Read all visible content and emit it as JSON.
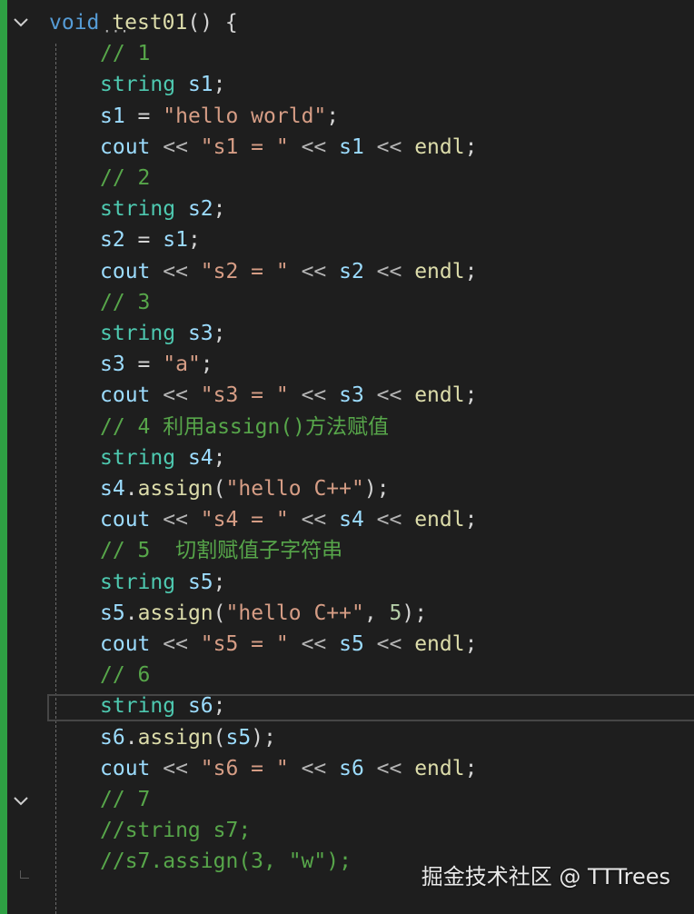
{
  "editor": {
    "lines": [
      {
        "indent": 0,
        "tokens": [
          {
            "t": "void",
            "c": "kw"
          },
          {
            "t": " ",
            "c": "punc"
          },
          {
            "t": "test01",
            "c": "fn"
          },
          {
            "t": "() {",
            "c": "punc"
          }
        ]
      },
      {
        "indent": 1,
        "tokens": [
          {
            "t": "// 1",
            "c": "cmt"
          }
        ]
      },
      {
        "indent": 1,
        "tokens": [
          {
            "t": "string",
            "c": "type"
          },
          {
            "t": " ",
            "c": "punc"
          },
          {
            "t": "s1",
            "c": "var"
          },
          {
            "t": ";",
            "c": "punc"
          }
        ]
      },
      {
        "indent": 1,
        "tokens": [
          {
            "t": "s1",
            "c": "var"
          },
          {
            "t": " = ",
            "c": "punc"
          },
          {
            "t": "\"hello world\"",
            "c": "str"
          },
          {
            "t": ";",
            "c": "punc"
          }
        ]
      },
      {
        "indent": 1,
        "tokens": [
          {
            "t": "cout",
            "c": "var"
          },
          {
            "t": " << ",
            "c": "op"
          },
          {
            "t": "\"s1 = \"",
            "c": "str"
          },
          {
            "t": " << ",
            "c": "op"
          },
          {
            "t": "s1",
            "c": "var"
          },
          {
            "t": " << ",
            "c": "op"
          },
          {
            "t": "endl",
            "c": "fn"
          },
          {
            "t": ";",
            "c": "punc"
          }
        ]
      },
      {
        "indent": 1,
        "tokens": [
          {
            "t": "// 2",
            "c": "cmt"
          }
        ]
      },
      {
        "indent": 1,
        "tokens": [
          {
            "t": "string",
            "c": "type"
          },
          {
            "t": " ",
            "c": "punc"
          },
          {
            "t": "s2",
            "c": "var"
          },
          {
            "t": ";",
            "c": "punc"
          }
        ]
      },
      {
        "indent": 1,
        "tokens": [
          {
            "t": "s2",
            "c": "var"
          },
          {
            "t": " = ",
            "c": "punc"
          },
          {
            "t": "s1",
            "c": "var"
          },
          {
            "t": ";",
            "c": "punc"
          }
        ]
      },
      {
        "indent": 1,
        "tokens": [
          {
            "t": "cout",
            "c": "var"
          },
          {
            "t": " << ",
            "c": "op"
          },
          {
            "t": "\"s2 = \"",
            "c": "str"
          },
          {
            "t": " << ",
            "c": "op"
          },
          {
            "t": "s2",
            "c": "var"
          },
          {
            "t": " << ",
            "c": "op"
          },
          {
            "t": "endl",
            "c": "fn"
          },
          {
            "t": ";",
            "c": "punc"
          }
        ]
      },
      {
        "indent": 1,
        "tokens": [
          {
            "t": "// 3",
            "c": "cmt"
          }
        ]
      },
      {
        "indent": 1,
        "tokens": [
          {
            "t": "string",
            "c": "type"
          },
          {
            "t": " ",
            "c": "punc"
          },
          {
            "t": "s3",
            "c": "var"
          },
          {
            "t": ";",
            "c": "punc"
          }
        ]
      },
      {
        "indent": 1,
        "tokens": [
          {
            "t": "s3",
            "c": "var"
          },
          {
            "t": " = ",
            "c": "punc"
          },
          {
            "t": "\"a\"",
            "c": "str"
          },
          {
            "t": ";",
            "c": "punc"
          }
        ]
      },
      {
        "indent": 1,
        "tokens": [
          {
            "t": "cout",
            "c": "var"
          },
          {
            "t": " << ",
            "c": "op"
          },
          {
            "t": "\"s3 = \"",
            "c": "str"
          },
          {
            "t": " << ",
            "c": "op"
          },
          {
            "t": "s3",
            "c": "var"
          },
          {
            "t": " << ",
            "c": "op"
          },
          {
            "t": "endl",
            "c": "fn"
          },
          {
            "t": ";",
            "c": "punc"
          }
        ]
      },
      {
        "indent": 1,
        "tokens": [
          {
            "t": "// 4 利用assign()方法赋值",
            "c": "cmt"
          }
        ]
      },
      {
        "indent": 1,
        "tokens": [
          {
            "t": "string",
            "c": "type"
          },
          {
            "t": " ",
            "c": "punc"
          },
          {
            "t": "s4",
            "c": "var"
          },
          {
            "t": ";",
            "c": "punc"
          }
        ]
      },
      {
        "indent": 1,
        "tokens": [
          {
            "t": "s4",
            "c": "var"
          },
          {
            "t": ".",
            "c": "punc"
          },
          {
            "t": "assign",
            "c": "fn"
          },
          {
            "t": "(",
            "c": "punc"
          },
          {
            "t": "\"hello C++\"",
            "c": "str"
          },
          {
            "t": ");",
            "c": "punc"
          }
        ]
      },
      {
        "indent": 1,
        "tokens": [
          {
            "t": "cout",
            "c": "var"
          },
          {
            "t": " << ",
            "c": "op"
          },
          {
            "t": "\"s4 = \"",
            "c": "str"
          },
          {
            "t": " << ",
            "c": "op"
          },
          {
            "t": "s4",
            "c": "var"
          },
          {
            "t": " << ",
            "c": "op"
          },
          {
            "t": "endl",
            "c": "fn"
          },
          {
            "t": ";",
            "c": "punc"
          }
        ]
      },
      {
        "indent": 1,
        "tokens": [
          {
            "t": "// 5  切割赋值子字符串",
            "c": "cmt"
          }
        ]
      },
      {
        "indent": 1,
        "tokens": [
          {
            "t": "string",
            "c": "type"
          },
          {
            "t": " ",
            "c": "punc"
          },
          {
            "t": "s5",
            "c": "var"
          },
          {
            "t": ";",
            "c": "punc"
          }
        ]
      },
      {
        "indent": 1,
        "tokens": [
          {
            "t": "s5",
            "c": "var"
          },
          {
            "t": ".",
            "c": "punc"
          },
          {
            "t": "assign",
            "c": "fn"
          },
          {
            "t": "(",
            "c": "punc"
          },
          {
            "t": "\"hello C++\"",
            "c": "str"
          },
          {
            "t": ", ",
            "c": "punc"
          },
          {
            "t": "5",
            "c": "num"
          },
          {
            "t": ");",
            "c": "punc"
          }
        ]
      },
      {
        "indent": 1,
        "tokens": [
          {
            "t": "cout",
            "c": "var"
          },
          {
            "t": " << ",
            "c": "op"
          },
          {
            "t": "\"s5 = \"",
            "c": "str"
          },
          {
            "t": " << ",
            "c": "op"
          },
          {
            "t": "s5",
            "c": "var"
          },
          {
            "t": " << ",
            "c": "op"
          },
          {
            "t": "endl",
            "c": "fn"
          },
          {
            "t": ";",
            "c": "punc"
          }
        ]
      },
      {
        "indent": 1,
        "tokens": [
          {
            "t": "// 6",
            "c": "cmt"
          }
        ]
      },
      {
        "indent": 1,
        "tokens": [
          {
            "t": "string",
            "c": "type"
          },
          {
            "t": " ",
            "c": "punc"
          },
          {
            "t": "s6",
            "c": "var"
          },
          {
            "t": ";",
            "c": "punc"
          }
        ]
      },
      {
        "indent": 1,
        "tokens": [
          {
            "t": "s6",
            "c": "var"
          },
          {
            "t": ".",
            "c": "punc"
          },
          {
            "t": "assign",
            "c": "fn"
          },
          {
            "t": "(",
            "c": "punc"
          },
          {
            "t": "s5",
            "c": "var"
          },
          {
            "t": ");",
            "c": "punc"
          }
        ]
      },
      {
        "indent": 1,
        "tokens": [
          {
            "t": "cout",
            "c": "var"
          },
          {
            "t": " << ",
            "c": "op"
          },
          {
            "t": "\"s6 = \"",
            "c": "str"
          },
          {
            "t": " << ",
            "c": "op"
          },
          {
            "t": "s6",
            "c": "var"
          },
          {
            "t": " << ",
            "c": "op"
          },
          {
            "t": "endl",
            "c": "fn"
          },
          {
            "t": ";",
            "c": "punc"
          }
        ]
      },
      {
        "indent": 1,
        "tokens": [
          {
            "t": "// 7",
            "c": "cmt"
          }
        ]
      },
      {
        "indent": 1,
        "tokens": [
          {
            "t": "//string s7;",
            "c": "cmt"
          }
        ]
      },
      {
        "indent": 1,
        "tokens": [
          {
            "t": "//s7.assign(3, \"w\");",
            "c": "cmt"
          }
        ]
      }
    ],
    "current_line_index": 22,
    "fold_markers": [
      0,
      25
    ],
    "colors": {
      "background": "#1e1e1e",
      "change_bar": "#2ea043",
      "keyword": "#569cd6",
      "function": "#dcdcaa",
      "type": "#4ec9b0",
      "variable": "#9cdcfe",
      "string": "#d69d85",
      "comment": "#57a64a",
      "number": "#b5cea8"
    },
    "icons": {
      "fold": "chevron-down-icon",
      "suggestion": "ellipsis-icon"
    }
  },
  "watermark": {
    "text": "掘金技术社区 @ TTTrees"
  }
}
